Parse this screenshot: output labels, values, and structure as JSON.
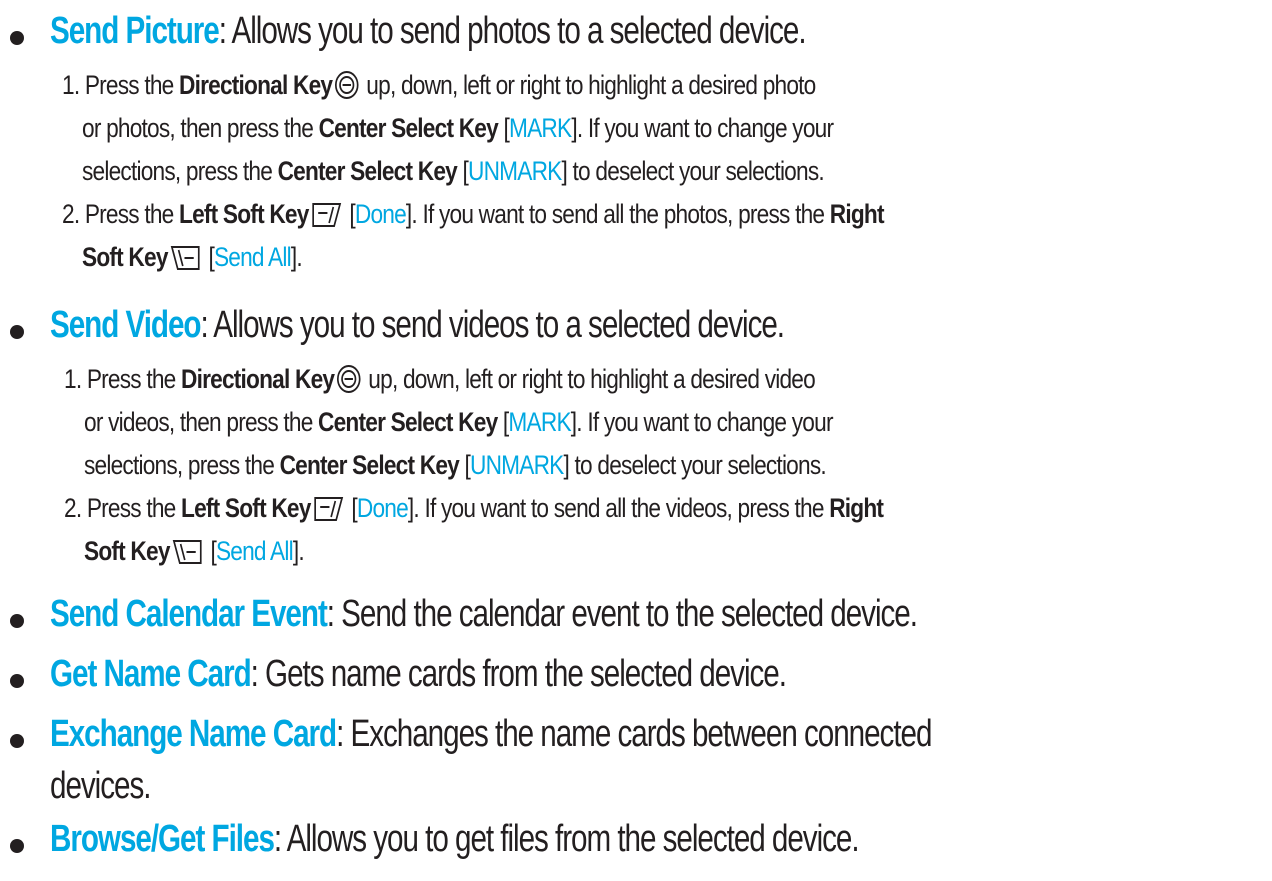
{
  "items": [
    {
      "term": "Send Picture",
      "desc": ": Allows you to send photos to a selected device.",
      "steps": {
        "s1": {
          "a": "1. Press the ",
          "b": "Directional Key",
          "c": " up, down, left or right to highlight a desired photo",
          "d": "or photos, then press the ",
          "e": "Center Select Key",
          "f": " [",
          "g": "MARK",
          "h": "]. If you want to change your",
          "i": "selections, press the ",
          "j": "Center Select Key",
          "k": " [",
          "l": "UNMARK",
          "m": "] to deselect your selections."
        },
        "s2": {
          "a": "2.  Press the ",
          "b": "Left Soft Key",
          "c": " [",
          "d": "Done",
          "e": "]. If you want to send all the photos, press the ",
          "f": "Right",
          "g": "Soft Key",
          "h": " [",
          "i": "Send All",
          "j": "]."
        }
      }
    },
    {
      "term": "Send Video",
      "desc": ": Allows you to send videos to a selected device.",
      "steps": {
        "s1": {
          "a": "1. Press the ",
          "b": "Directional Key",
          "c": " up, down, left or right to highlight a desired video",
          "d": "or videos, then press the ",
          "e": "Center Select Key",
          "f": " [",
          "g": "MARK",
          "h": "]. If you want to change your",
          "i": "selections, press the ",
          "j": "Center Select Key",
          "k": " [",
          "l": "UNMARK",
          "m": "] to deselect your selections."
        },
        "s2": {
          "a": "2.  Press the ",
          "b": "Left Soft Key",
          "c": " [",
          "d": "Done",
          "e": "]. If you want to send all the videos, press the ",
          "f": "Right",
          "g": "Soft Key",
          "h": " [",
          "i": "Send All",
          "j": "]."
        }
      }
    },
    {
      "term": "Send Calendar Event",
      "desc": ": Send the calendar event to the selected device."
    },
    {
      "term": "Get Name Card",
      "desc": ": Gets name cards from the selected device."
    },
    {
      "term": "Exchange Name Card",
      "desc": ": Exchanges the name cards between connected",
      "desc2": "devices."
    },
    {
      "term": "Browse/Get Files",
      "desc": ": Allows you to get files from the selected device."
    }
  ],
  "colors": {
    "accent": "#00a7e1",
    "text": "#231f20"
  },
  "icons": {
    "directional": "directional-key-icon",
    "left_soft": "left-soft-key-icon",
    "right_soft": "right-soft-key-icon"
  }
}
